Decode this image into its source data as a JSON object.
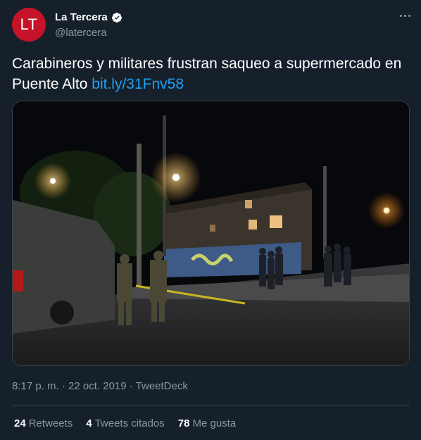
{
  "author": {
    "avatar_text": "LT",
    "name": "La Tercera",
    "handle": "@latercera",
    "verified": true
  },
  "tweet": {
    "text": "Carabineros y militares frustran saqueo a supermercado en Puente Alto ",
    "link": "bit.ly/31Fnv58",
    "meta": "8:17 p. m. · 22 oct. 2019 · TweetDeck"
  },
  "stats": [
    {
      "count": "24",
      "label": "Retweets"
    },
    {
      "count": "4",
      "label": "Tweets citados"
    },
    {
      "count": "78",
      "label": "Me gusta"
    }
  ],
  "colors": {
    "background": "#15202b",
    "text": "#ffffff",
    "secondary": "#8899a6",
    "link": "#1da1f2",
    "avatar": "#c7132a",
    "divider": "#38444d"
  },
  "icons": {
    "verified": "verified-badge-icon",
    "more": "more-options-icon"
  }
}
